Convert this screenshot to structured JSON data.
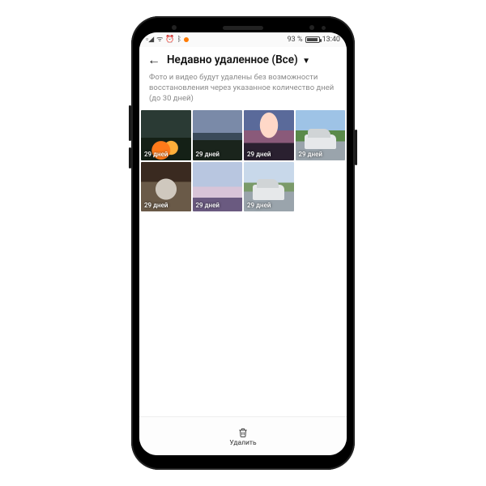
{
  "status": {
    "battery_percent": "93 %",
    "time": "13:40"
  },
  "header": {
    "title": "Недавно удаленное (Все)"
  },
  "description": "Фото и видео будут удалены без возможности восстановления через указанное количество дней (до 30 дней)",
  "thumbnails": [
    {
      "days_label": "29 дней"
    },
    {
      "days_label": "29 дней"
    },
    {
      "days_label": "29 дней"
    },
    {
      "days_label": "29 дней"
    },
    {
      "days_label": "29 дней"
    },
    {
      "days_label": "29 дней"
    },
    {
      "days_label": "29 дней"
    }
  ],
  "bottom": {
    "delete_label": "Удалить"
  }
}
